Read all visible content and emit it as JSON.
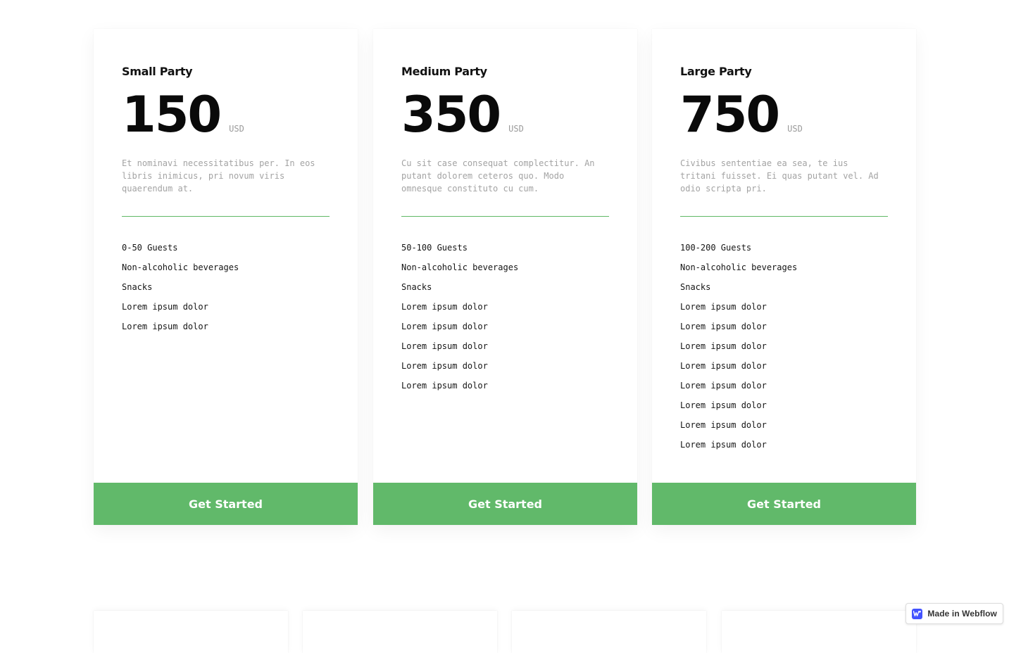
{
  "plans": [
    {
      "name": "Small Party",
      "price": "150",
      "currency": "USD",
      "description": "Et nominavi necessitatibus per. In eos libris inimicus, pri novum viris quaerendum at.",
      "features": [
        "0-50 Guests",
        "Non-alcoholic beverages",
        "Snacks",
        "Lorem ipsum dolor",
        "Lorem ipsum dolor"
      ],
      "cta": "Get Started"
    },
    {
      "name": "Medium Party",
      "price": "350",
      "currency": "USD",
      "description": "Cu sit case consequat complectitur. An putant dolorem ceteros quo. Modo omnesque constituto cu cum.",
      "features": [
        "50-100 Guests",
        "Non-alcoholic beverages",
        "Snacks",
        "Lorem ipsum dolor",
        "Lorem ipsum dolor",
        "Lorem ipsum dolor",
        "Lorem ipsum dolor",
        "Lorem ipsum dolor"
      ],
      "cta": "Get Started"
    },
    {
      "name": "Large Party",
      "price": "750",
      "currency": "USD",
      "description": "Civibus sententiae ea sea, te ius tritani fuisset. Ei quas putant vel. Ad odio scripta pri.",
      "features": [
        "100-200 Guests",
        "Non-alcoholic beverages",
        "Snacks",
        "Lorem ipsum dolor",
        "Lorem ipsum dolor",
        "Lorem ipsum dolor",
        "Lorem ipsum dolor",
        "Lorem ipsum dolor",
        "Lorem ipsum dolor",
        "Lorem ipsum dolor",
        "Lorem ipsum dolor"
      ],
      "cta": "Get Started"
    }
  ],
  "colors": {
    "accent": "#61b96a",
    "divider": "#5fb866",
    "muted_text": "#a3a3a3",
    "webflow_blue": "#4353ff"
  },
  "badge": {
    "icon": "webflow-logo-icon",
    "label": "Made in Webflow"
  }
}
